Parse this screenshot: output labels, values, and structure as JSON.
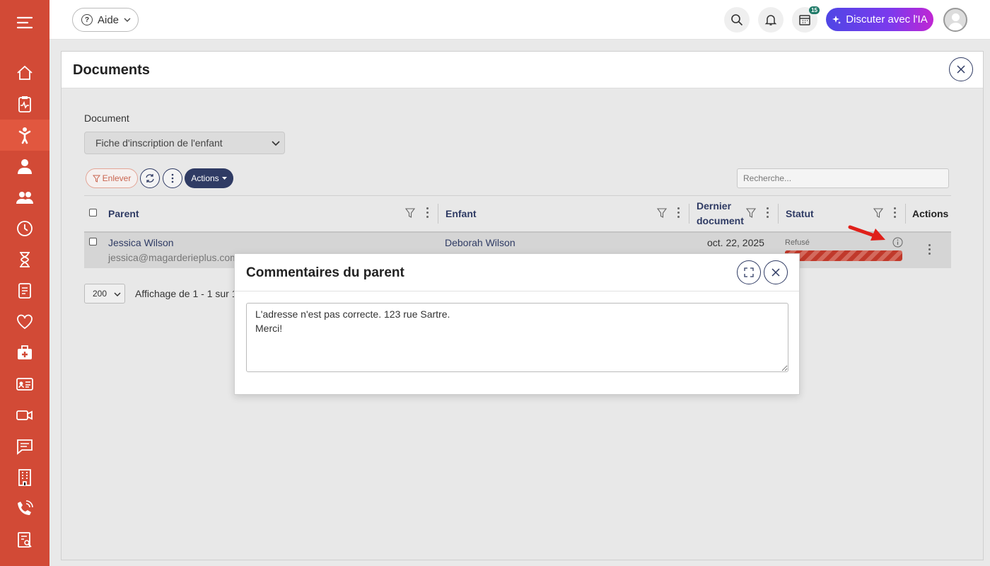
{
  "topbar": {
    "help_label": "Aide",
    "calendar_badge": "15",
    "ai_button_label": "Discuter avec l'IA"
  },
  "panel": {
    "title": "Documents",
    "document_label": "Document",
    "document_select_value": "Fiche d'inscription de l'enfant",
    "enlever_label": "Enlever",
    "actions_label": "Actions",
    "search_placeholder": "Recherche..."
  },
  "table": {
    "headers": {
      "parent": "Parent",
      "enfant": "Enfant",
      "dernier_line1": "Dernier",
      "dernier_line2": "document",
      "statut": "Statut",
      "actions": "Actions"
    },
    "row": {
      "parent_name": "Jessica Wilson",
      "parent_email": "jessica@magarderieplus.com",
      "child_name": "Deborah Wilson",
      "date": "oct. 22, 2025",
      "status": "Refusé"
    }
  },
  "pagination": {
    "page_size": "200",
    "info": "Affichage de 1 - 1 sur 1"
  },
  "modal": {
    "title": "Commentaires du parent",
    "comment": "L'adresse n'est pas correcte. 123 rue Sartre.\nMerci!"
  },
  "colors": {
    "sidebar": "#d24a36",
    "primary": "#2f3b64",
    "status_refused": "#c0392b"
  },
  "sidebar_icons": [
    "menu-icon",
    "home-icon",
    "clipboard-pulse-icon",
    "child-icon",
    "person-icon",
    "group-icon",
    "clock-icon",
    "hourglass-icon",
    "form-icon",
    "heart-icon",
    "medical-kit-icon",
    "id-card-icon",
    "video-icon",
    "chat-icon",
    "building-icon",
    "phone-icon",
    "report-icon"
  ]
}
